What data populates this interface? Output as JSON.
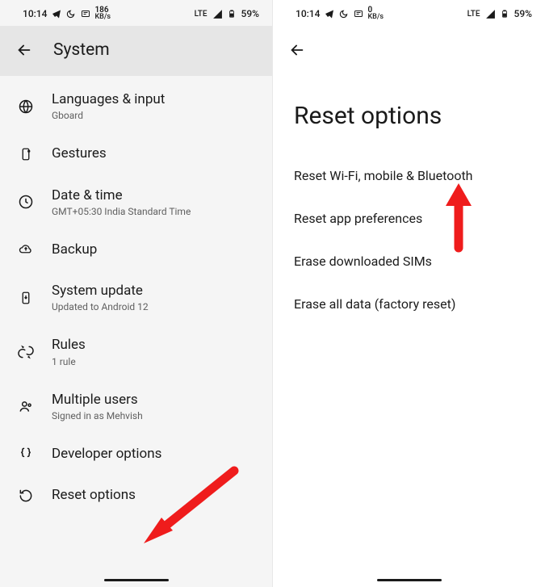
{
  "statusbar": {
    "time": "10:14",
    "kbs_left": "186",
    "kbs_right": "0",
    "kbs_unit": "KB/s",
    "network": "LTE",
    "battery": "59%"
  },
  "screen_left": {
    "header_title": "System",
    "items": [
      {
        "key": "languages",
        "label": "Languages & input",
        "sub": "Gboard"
      },
      {
        "key": "gestures",
        "label": "Gestures",
        "sub": ""
      },
      {
        "key": "datetime",
        "label": "Date & time",
        "sub": "GMT+05:30 India Standard Time"
      },
      {
        "key": "backup",
        "label": "Backup",
        "sub": ""
      },
      {
        "key": "update",
        "label": "System update",
        "sub": "Updated to Android 12"
      },
      {
        "key": "rules",
        "label": "Rules",
        "sub": "1 rule"
      },
      {
        "key": "multiusers",
        "label": "Multiple users",
        "sub": "Signed in as Mehvish"
      },
      {
        "key": "devopts",
        "label": "Developer options",
        "sub": ""
      },
      {
        "key": "reset",
        "label": "Reset options",
        "sub": ""
      }
    ]
  },
  "screen_right": {
    "title": "Reset options",
    "options": [
      "Reset Wi-Fi, mobile & Bluetooth",
      "Reset app preferences",
      "Erase downloaded SIMs",
      "Erase all data (factory reset)"
    ]
  }
}
